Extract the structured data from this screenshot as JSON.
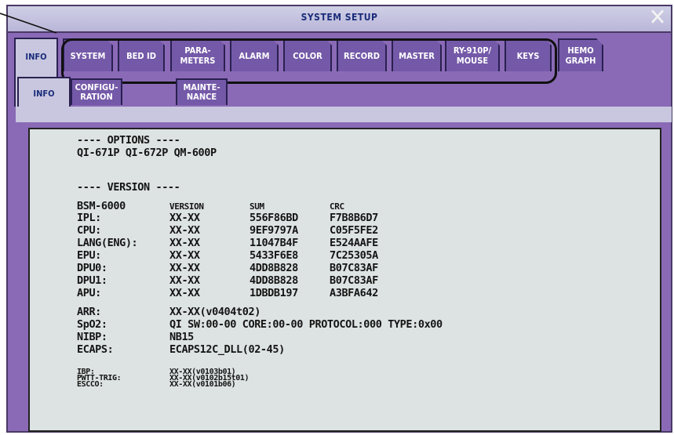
{
  "window": {
    "title": "SYSTEM SETUP",
    "close_symbol": "✕"
  },
  "top_tabs": [
    {
      "label": "INFO"
    },
    {
      "label": "SYSTEM"
    },
    {
      "label": "BED ID"
    },
    {
      "label": "PARA-\nMETERS"
    },
    {
      "label": "ALARM"
    },
    {
      "label": "COLOR"
    },
    {
      "label": "RECORD"
    },
    {
      "label": "MASTER"
    },
    {
      "label": "RY-910P/\nMOUSE"
    },
    {
      "label": "KEYS"
    },
    {
      "label": "HEMO\nGRAPH"
    }
  ],
  "sub_tabs": [
    {
      "label": "INFO"
    },
    {
      "label": "CONFIGU-\nRATION"
    },
    {
      "label": "MAINTE-\nNANCE"
    }
  ],
  "info": {
    "options_header": "---- OPTIONS ----",
    "options_value": "QI-671P QI-672P QM-600P",
    "version_header": "---- VERSION ----",
    "col_headers": [
      "BSM-6000",
      "VERSION",
      "SUM",
      "CRC"
    ],
    "rows": [
      [
        "IPL:",
        "XX-XX",
        "556F86BD",
        "F7B8B6D7"
      ],
      [
        "CPU:",
        "XX-XX",
        "9EF9797A",
        "C05F5FE2"
      ],
      [
        "LANG(ENG):",
        "XX-XX",
        "11047B4F",
        "E524AAFE"
      ],
      [
        "EPU:",
        "XX-XX",
        "5433F6E8",
        "7C25305A"
      ],
      [
        "DPU0:",
        "XX-XX",
        "4DD8B828",
        "B07C83AF"
      ],
      [
        "DPU1:",
        "XX-XX",
        "4DD8B828",
        "B07C83AF"
      ],
      [
        "APU:",
        "XX-XX",
        "1DBDB197",
        "A3BFA642"
      ]
    ],
    "extra": [
      [
        "ARR:",
        "XX-XX(v0404t02)"
      ],
      [
        "SpO2:",
        "QI SW:00-00 CORE:00-00 PROTOCOL:000 TYPE:0x00"
      ],
      [
        "NIBP:",
        "NB15"
      ],
      [
        "ECAPS:",
        "ECAPS12C_DLL(02-45)"
      ]
    ],
    "small": [
      [
        "IBP:",
        "XX-XX(v0103b01)"
      ],
      [
        "PWTT-TRIG:",
        "XX-XX(v0102b15t01)"
      ],
      [
        "ESCCO:",
        "XX-XX(v0101b06)"
      ]
    ]
  }
}
